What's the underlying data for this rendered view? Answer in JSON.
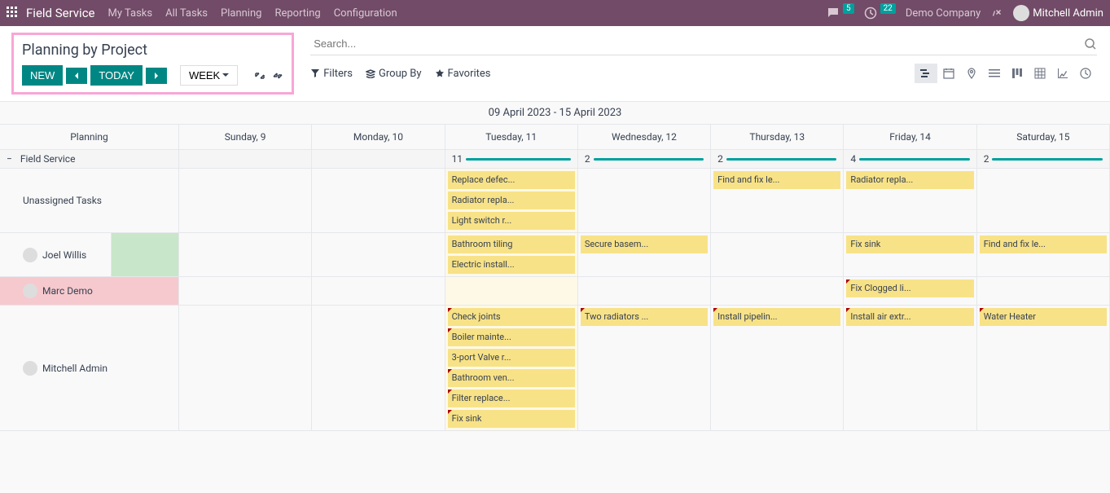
{
  "topnav": {
    "brand": "Field Service",
    "menu": [
      "My Tasks",
      "All Tasks",
      "Planning",
      "Reporting",
      "Configuration"
    ],
    "conversations_badge": "5",
    "activities_badge": "22",
    "company": "Demo Company",
    "user": "Mitchell Admin"
  },
  "control": {
    "title": "Planning by Project",
    "new_label": "NEW",
    "today_label": "TODAY",
    "scale_label": "WEEK"
  },
  "search": {
    "placeholder": "Search...",
    "filters_label": "Filters",
    "groupby_label": "Group By",
    "favorites_label": "Favorites"
  },
  "gantt": {
    "date_range": "09 April 2023 - 15 April 2023",
    "row_header": "Planning",
    "days": [
      "Sunday, 9",
      "Monday, 10",
      "Tuesday, 11",
      "Wednesday, 12",
      "Thursday, 13",
      "Friday, 14",
      "Saturday, 15"
    ],
    "group": {
      "label": "Field Service",
      "counts": [
        "",
        "",
        "11",
        "2",
        "2",
        "4",
        "2"
      ]
    },
    "rows": [
      {
        "label": "Unassigned Tasks",
        "avatar": false,
        "highlight": false,
        "cells": [
          {
            "tasks": []
          },
          {
            "tasks": []
          },
          {
            "tasks": [
              {
                "t": "Replace defec..."
              },
              {
                "t": "Radiator repla..."
              },
              {
                "t": "Light switch r..."
              }
            ]
          },
          {
            "tasks": []
          },
          {
            "tasks": [
              {
                "t": "Find and fix le..."
              }
            ]
          },
          {
            "tasks": [
              {
                "t": "Radiator repla..."
              }
            ]
          },
          {
            "tasks": []
          }
        ]
      },
      {
        "label": "Joel Willis",
        "avatar": true,
        "highlight": false,
        "green_stripe": true,
        "cells": [
          {
            "tasks": []
          },
          {
            "tasks": []
          },
          {
            "tasks": [
              {
                "t": "Bathroom tiling"
              },
              {
                "t": "Electric install..."
              }
            ]
          },
          {
            "tasks": [
              {
                "t": "Secure basem..."
              }
            ]
          },
          {
            "tasks": []
          },
          {
            "tasks": [
              {
                "t": "Fix sink"
              }
            ]
          },
          {
            "tasks": [
              {
                "t": "Find and fix le..."
              }
            ]
          }
        ]
      },
      {
        "label": "Marc Demo",
        "avatar": true,
        "highlight": true,
        "cells": [
          {
            "tasks": []
          },
          {
            "tasks": []
          },
          {
            "tasks": []
          },
          {
            "tasks": []
          },
          {
            "tasks": []
          },
          {
            "tasks": [
              {
                "t": "Fix Clogged li...",
                "flag": true
              }
            ]
          },
          {
            "tasks": []
          }
        ]
      },
      {
        "label": "Mitchell Admin",
        "avatar": true,
        "highlight": false,
        "cells": [
          {
            "tasks": []
          },
          {
            "tasks": []
          },
          {
            "tasks": [
              {
                "t": "Check joints",
                "flag": true
              },
              {
                "t": "Boiler mainte...",
                "flag": true
              },
              {
                "t": "3-port Valve r..."
              },
              {
                "t": "Bathroom ven...",
                "flag": true
              },
              {
                "t": "Filter replace...",
                "flag": true
              },
              {
                "t": "Fix sink",
                "flag": true
              }
            ]
          },
          {
            "tasks": [
              {
                "t": "Two radiators ...",
                "flag": true
              }
            ]
          },
          {
            "tasks": [
              {
                "t": "Install pipelin...",
                "flag": true
              }
            ]
          },
          {
            "tasks": [
              {
                "t": "Install air extr...",
                "flag": true
              }
            ]
          },
          {
            "tasks": [
              {
                "t": "Water Heater",
                "flag": true
              }
            ]
          }
        ]
      }
    ]
  }
}
